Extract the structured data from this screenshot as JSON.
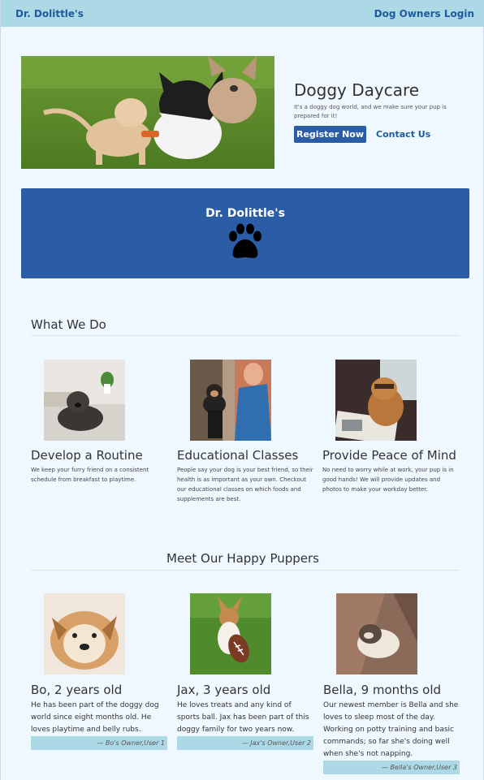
{
  "navbar": {
    "brand": "Dr. Dolittle's",
    "login": "Dog Owners Login"
  },
  "hero": {
    "title": "Doggy Daycare",
    "subtitle": "It's a doggy dog world, and we make sure your pup is prepared for it!",
    "register": "Register Now",
    "contact": "Contact Us"
  },
  "banner": {
    "title": "Dr. Dolittle's"
  },
  "services": {
    "title": "What We Do",
    "items": [
      {
        "title": "Develop a Routine",
        "text": "We keep your furry friend on a consistent schedule from breakfast to playtime."
      },
      {
        "title": "Educational Classes",
        "text": "People say your dog is your best friend, so their health is as important as your own. Checkout our educational classes on which foods and supplements are best."
      },
      {
        "title": "Provide Peace of Mind",
        "text": "No need to worry while at work, your pup is in good hands! We will provide updates and photos to make your workday better."
      }
    ]
  },
  "puppers": {
    "title": "Meet Our Happy Puppers",
    "items": [
      {
        "title": "Bo, 2 years old",
        "text": "He has been part of the doggy dog world since eight months old. He loves playtime and belly rubs.",
        "quote": "— Bo's Owner,User 1"
      },
      {
        "title": "Jax, 3 years old",
        "text": "He loves treats and any kind of sports ball. Jax has been part of this doggy family for two years now.",
        "quote": "— Jax's Owner,User 2"
      },
      {
        "title": "Bella, 9 months old",
        "text": "Our newest member is Bella and she loves to sleep most of the day. Working on potty training and basic commands; so far she's doing well when she's not napping.",
        "quote": "— Bella's Owner,User 3"
      }
    ]
  },
  "colors": {
    "nav": "#add8e6",
    "accent": "#2a5da5",
    "page": "#f0f8ff"
  }
}
